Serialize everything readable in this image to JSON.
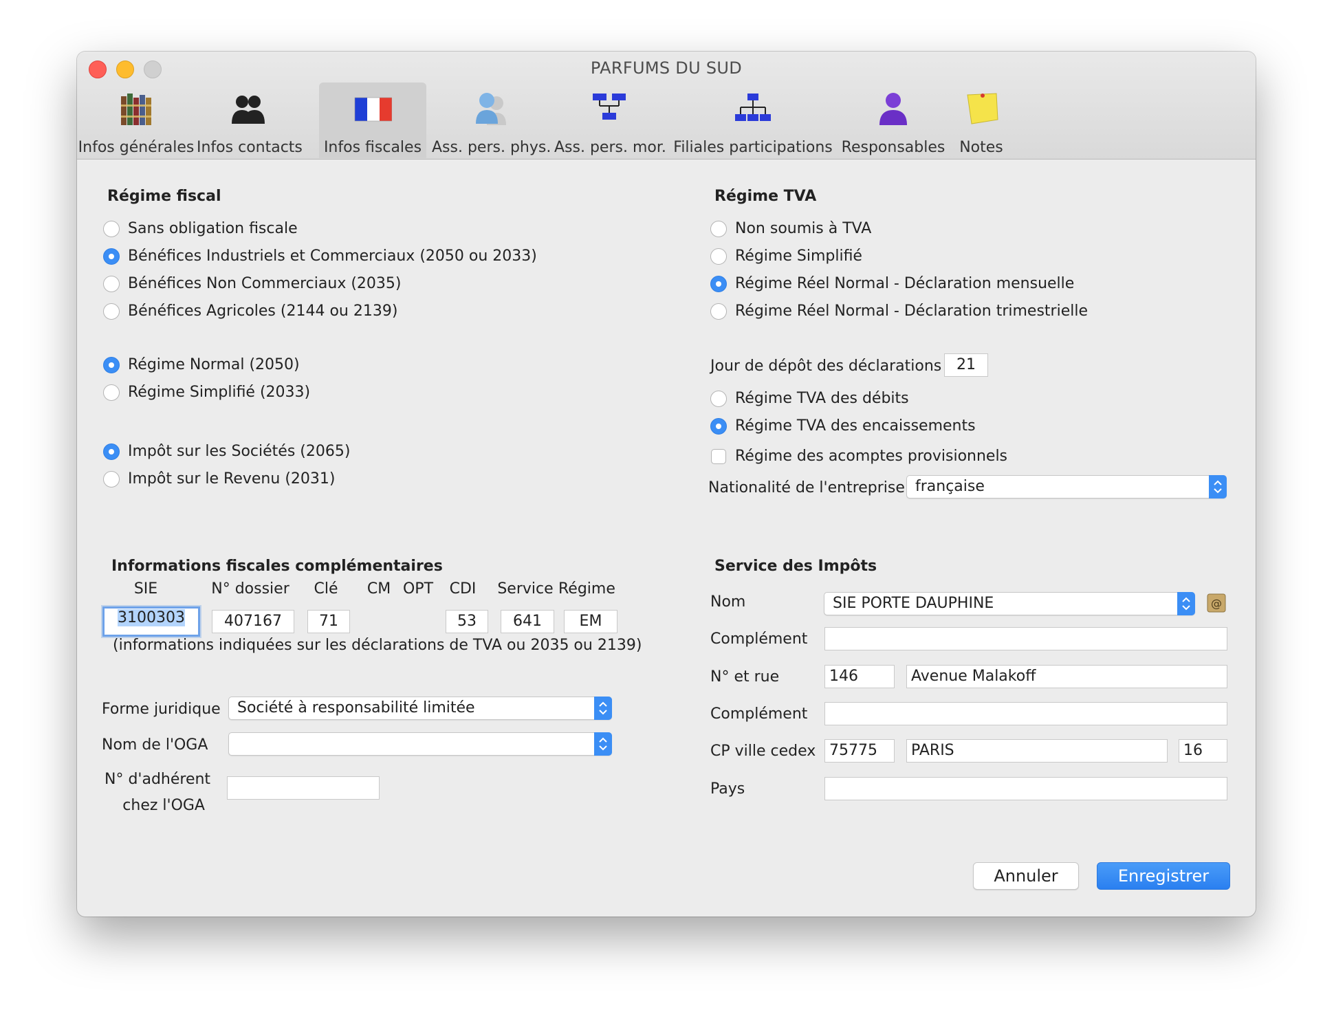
{
  "window": {
    "title": "PARFUMS DU SUD"
  },
  "toolbar": {
    "items": [
      {
        "label": "Infos générales",
        "icon": "books-icon"
      },
      {
        "label": "Infos contacts",
        "icon": "people-icon"
      },
      {
        "label": "Infos fiscales",
        "icon": "french-flag-icon",
        "active": true
      },
      {
        "label": "Ass. pers. phys.",
        "icon": "persons-icon"
      },
      {
        "label": "Ass. pers. mor.",
        "icon": "org-chart-icon"
      },
      {
        "label": "Filiales participations",
        "icon": "hierarchy-icon"
      },
      {
        "label": "Responsables",
        "icon": "person-icon"
      },
      {
        "label": "Notes",
        "icon": "sticky-note-icon"
      }
    ]
  },
  "regime_fiscal": {
    "title": "Régime fiscal",
    "options": [
      {
        "label": "Sans obligation fiscale",
        "selected": false
      },
      {
        "label": "Bénéfices Industriels et Commerciaux (2050 ou 2033)",
        "selected": true
      },
      {
        "label": "Bénéfices Non Commerciaux (2035)",
        "selected": false
      },
      {
        "label": "Bénéfices Agricoles (2144 ou 2139)",
        "selected": false
      }
    ],
    "regime_options": [
      {
        "label": "Régime Normal (2050)",
        "selected": true
      },
      {
        "label": "Régime Simplifié (2033)",
        "selected": false
      }
    ],
    "impot_options": [
      {
        "label": "Impôt sur les Sociétés (2065)",
        "selected": true
      },
      {
        "label": "Impôt sur le Revenu (2031)",
        "selected": false
      }
    ]
  },
  "regime_tva": {
    "title": "Régime TVA",
    "options": [
      {
        "label": "Non soumis à TVA",
        "selected": false
      },
      {
        "label": "Régime Simplifié",
        "selected": false
      },
      {
        "label": "Régime Réel Normal - Déclaration mensuelle",
        "selected": true
      },
      {
        "label": "Régime Réel Normal - Déclaration trimestrielle",
        "selected": false
      }
    ],
    "jour_depot_label": "Jour de dépôt des déclarations",
    "jour_depot_value": "21",
    "debit_options": [
      {
        "label": "Régime TVA des débits",
        "selected": false
      },
      {
        "label": "Régime TVA des encaissements",
        "selected": true
      }
    ],
    "acomptes_label": "Régime des acomptes provisionnels",
    "acomptes_checked": false,
    "nationalite_label": "Nationalité de l'entreprise",
    "nationalite_value": "française"
  },
  "infos_complementaires": {
    "title": "Informations fiscales complémentaires",
    "columns": [
      "SIE",
      "N° dossier",
      "Clé",
      "CM",
      "OPT",
      "CDI",
      "Service",
      "Régime"
    ],
    "values": {
      "sie": "3100303",
      "dossier": "407167",
      "cle": "71",
      "cdi": "53",
      "service": "641",
      "regime": "EM"
    },
    "note": "(informations indiquées sur les déclarations de TVA ou 2035 ou 2139)"
  },
  "juridique": {
    "forme_label": "Forme juridique",
    "forme_value": "Société à responsabilité limitée",
    "oga_label": "Nom de l'OGA",
    "oga_value": "",
    "adherent_label_1": "N° d'adhérent",
    "adherent_label_2": "chez l'OGA",
    "adherent_value": ""
  },
  "service_impots": {
    "title": "Service des Impôts",
    "nom_label": "Nom",
    "nom_value": "SIE PORTE DAUPHINE",
    "complement1_label": "Complément",
    "complement1_value": "",
    "rue_label": "N° et rue",
    "rue_numero": "146",
    "rue_nom": "Avenue Malakoff",
    "complement2_label": "Complément",
    "complement2_value": "",
    "cp_label": "CP ville cedex",
    "cp_value": "75775",
    "ville_value": "PARIS",
    "cedex_value": "16",
    "pays_label": "Pays",
    "pays_value": ""
  },
  "buttons": {
    "cancel": "Annuler",
    "save": "Enregistrer"
  },
  "colors": {
    "accent": "#3b8ef5",
    "focus_ring": "#6ea2e9",
    "window_bg": "#ececec"
  }
}
